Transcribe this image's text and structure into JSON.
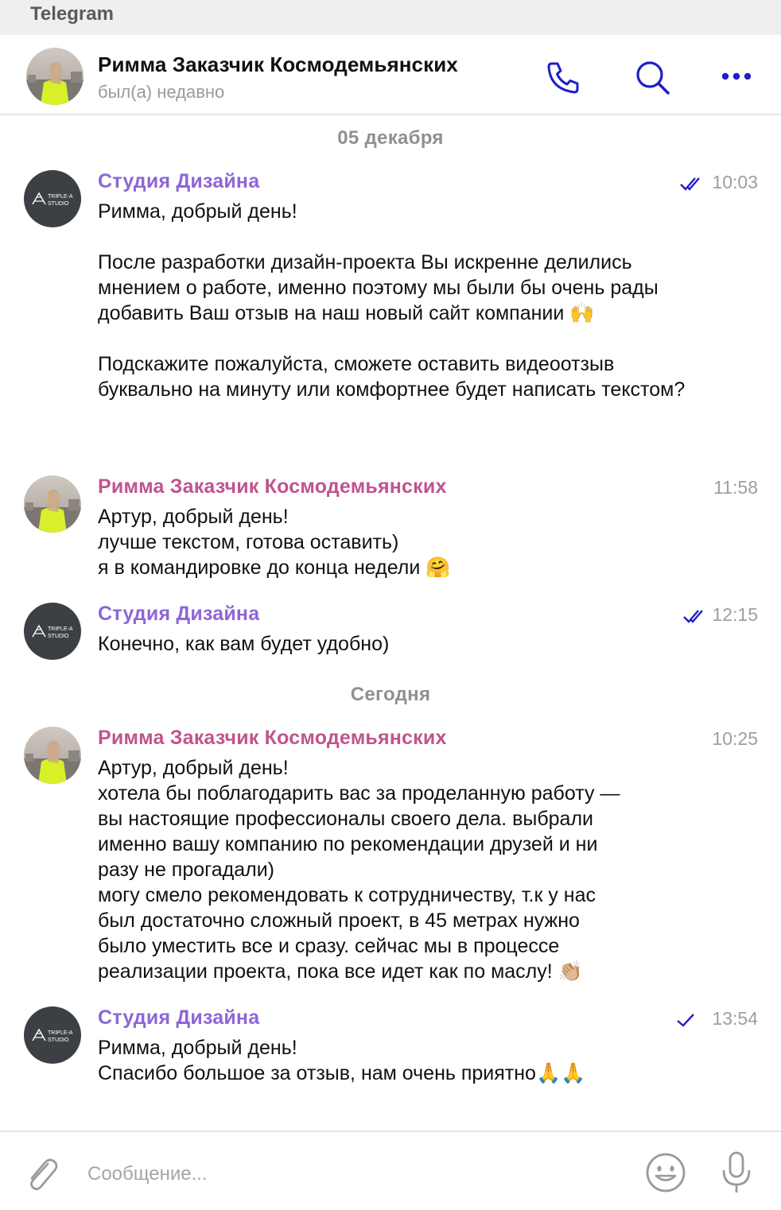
{
  "window": {
    "app_title": "Telegram"
  },
  "header": {
    "peer_name": "Римма Заказчик Космодемьянских",
    "peer_status": "был(а) недавно",
    "icons": [
      "phone-icon",
      "search-icon",
      "more-icon"
    ]
  },
  "colors": {
    "accent": "#1f1fc6",
    "studio_name": "#8e66d6",
    "client_name": "#c0548e",
    "muted": "#9e9e9e",
    "divider": "#e6e6e6"
  },
  "date_separators": [
    "05 декабря",
    "Сегодня"
  ],
  "studio_avatar": {
    "line1": "TRIPLE-A",
    "line2": "STUDIO"
  },
  "messages": [
    {
      "sender": "Студия Дизайна",
      "time": "10:03",
      "read": true,
      "text": "Римма, добрый день!\n\nПосле разработки дизайн-проекта Вы искренне делились мнением о работе, именно поэтому мы были бы очень рады добавить Ваш отзыв на наш новый сайт компании 🙌\n\nПодскажите пожалуйста, сможете оставить видеоотзыв буквально на минуту или комфортнее будет написать текстом?"
    },
    {
      "sender": "Римма Заказчик Космодемьянских",
      "time": "11:58",
      "text": "Артур, добрый день!\nлучше текстом, готова оставить)\nя в командировке до конца недели 🤗"
    },
    {
      "sender": "Студия Дизайна",
      "time": "12:15",
      "read": true,
      "text": "Конечно, как вам будет удобно)"
    },
    {
      "sender": "Римма Заказчик Космодемьянских",
      "time": "10:25",
      "text": "Артур, добрый день!\nхотела бы поблагодарить вас за проделанную работу —\nвы настоящие профессионалы своего дела. выбрали\nименно вашу компанию по рекомендации друзей и ни\nразу не прогадали)\nмогу смело рекомендовать к сотрудничеству, т.к у нас\nбыл достаточно сложный проект, в 45 метрах нужно\nбыло уместить все и сразу. сейчас мы в процессе\nреализации проекта, пока все идет как по маслу! 👏🏼"
    },
    {
      "sender": "Студия Дизайна",
      "time": "13:54",
      "read": false,
      "text": "Римма, добрый день!\nСпасибо большое за отзыв, нам очень приятно🙏🙏"
    }
  ],
  "composer": {
    "placeholder": "Сообщение...",
    "icons": [
      "attach-icon",
      "emoji-icon",
      "microphone-icon"
    ]
  }
}
